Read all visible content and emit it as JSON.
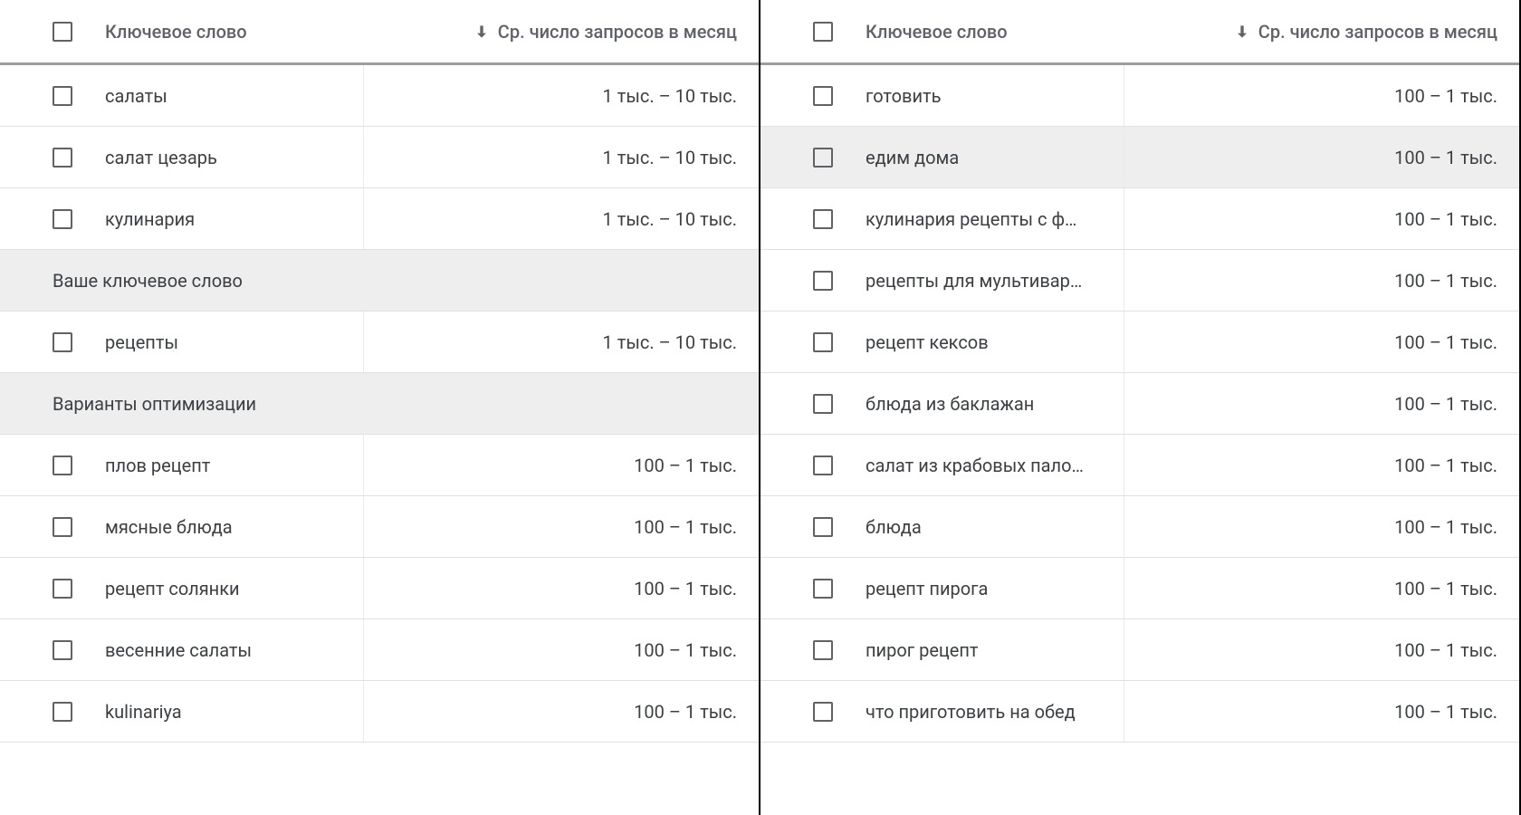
{
  "headers": {
    "keyword": "Ключевое слово",
    "volume": "Ср. число запросов в месяц"
  },
  "left": {
    "rows_top": [
      {
        "keyword": "салаты",
        "volume": "1 тыс. – 10 тыс."
      },
      {
        "keyword": "салат цезарь",
        "volume": "1 тыс. – 10 тыс."
      },
      {
        "keyword": "кулинария",
        "volume": "1 тыс. – 10 тыс."
      }
    ],
    "section_your_keyword": "Ваше ключевое слово",
    "rows_your": [
      {
        "keyword": "рецепты",
        "volume": "1 тыс. – 10 тыс."
      }
    ],
    "section_optimization": "Варианты оптимизации",
    "rows_opt": [
      {
        "keyword": "плов рецепт",
        "volume": "100 – 1 тыс."
      },
      {
        "keyword": "мясные блюда",
        "volume": "100 – 1 тыс."
      },
      {
        "keyword": "рецепт солянки",
        "volume": "100 – 1 тыс."
      },
      {
        "keyword": "весенние салаты",
        "volume": "100 – 1 тыс."
      },
      {
        "keyword": "kulinariya",
        "volume": "100 – 1 тыс."
      }
    ]
  },
  "right": {
    "rows": [
      {
        "keyword": "готовить",
        "volume": "100 – 1 тыс.",
        "highlight": false
      },
      {
        "keyword": "едим дома",
        "volume": "100 – 1 тыс.",
        "highlight": true
      },
      {
        "keyword": "кулинария рецепты с ф…",
        "volume": "100 – 1 тыс.",
        "highlight": false
      },
      {
        "keyword": "рецепты для мультивар…",
        "volume": "100 – 1 тыс.",
        "highlight": false
      },
      {
        "keyword": "рецепт кексов",
        "volume": "100 – 1 тыс.",
        "highlight": false
      },
      {
        "keyword": "блюда из баклажан",
        "volume": "100 – 1 тыс.",
        "highlight": false
      },
      {
        "keyword": "салат из крабовых пало…",
        "volume": "100 – 1 тыс.",
        "highlight": false
      },
      {
        "keyword": "блюда",
        "volume": "100 – 1 тыс.",
        "highlight": false
      },
      {
        "keyword": "рецепт пирога",
        "volume": "100 – 1 тыс.",
        "highlight": false
      },
      {
        "keyword": "пирог рецепт",
        "volume": "100 – 1 тыс.",
        "highlight": false
      },
      {
        "keyword": "что приготовить на обед",
        "volume": "100 – 1 тыс.",
        "highlight": false
      }
    ]
  }
}
